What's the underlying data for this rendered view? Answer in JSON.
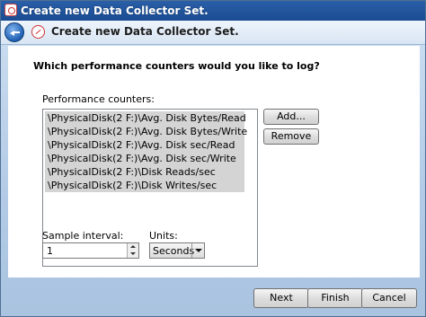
{
  "window": {
    "title": "Create new Data Collector Set."
  },
  "header": {
    "title": "Create new Data Collector Set."
  },
  "main": {
    "question": "Which performance counters would you like to log?",
    "counters_label": "Performance counters:",
    "counters": [
      "\\PhysicalDisk(2 F:)\\Avg. Disk Bytes/Read",
      "\\PhysicalDisk(2 F:)\\Avg. Disk Bytes/Write",
      "\\PhysicalDisk(2 F:)\\Avg. Disk sec/Read",
      "\\PhysicalDisk(2 F:)\\Avg. Disk sec/Write",
      "\\PhysicalDisk(2 F:)\\Disk Reads/sec",
      "\\PhysicalDisk(2 F:)\\Disk Writes/sec"
    ],
    "add_label": "Add...",
    "remove_label": "Remove",
    "sample_interval_label": "Sample interval:",
    "sample_interval_value": "1",
    "units_label": "Units:",
    "units_value": "Seconds"
  },
  "footer": {
    "next": "Next",
    "finish": "Finish",
    "cancel": "Cancel"
  }
}
